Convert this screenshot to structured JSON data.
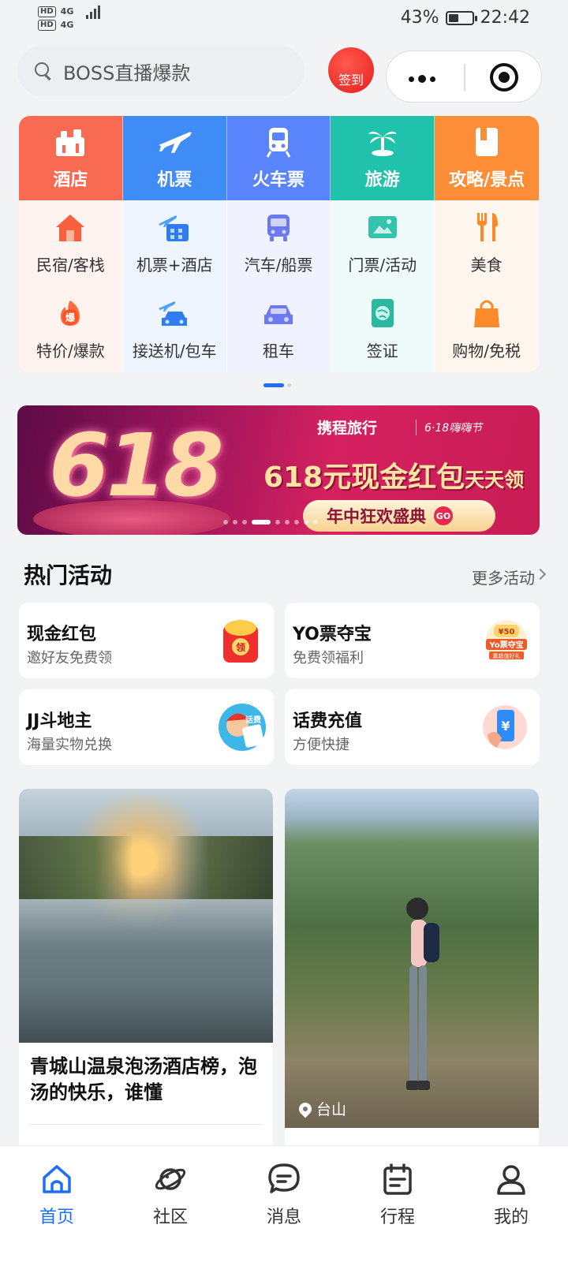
{
  "status_bar": {
    "sim1": "HD",
    "sim2": "HD",
    "net1": "4G",
    "net2": "4G",
    "battery": "43%",
    "battery_level": 0.43,
    "time": "22:42"
  },
  "search": {
    "placeholder": "BOSS直播爆款"
  },
  "signin": {
    "label": "签到"
  },
  "main_services": [
    {
      "label": "酒店",
      "icon": "hotel-icon",
      "color": "#f86a52"
    },
    {
      "label": "机票",
      "icon": "plane-icon",
      "color": "#3f8cf6"
    },
    {
      "label": "火车票",
      "icon": "train-icon",
      "color": "#5a84fb"
    },
    {
      "label": "旅游",
      "icon": "palm-tree-icon",
      "color": "#21c2ac"
    },
    {
      "label": "攻略/景点",
      "icon": "guide-book-icon",
      "color": "#fd8d36"
    }
  ],
  "sub_services_row1": [
    {
      "label": "民宿/客栈",
      "icon": "house-icon"
    },
    {
      "label": "机票+酒店",
      "icon": "plane-hotel-icon"
    },
    {
      "label": "汽车/船票",
      "icon": "bus-icon"
    },
    {
      "label": "门票/活动",
      "icon": "ticket-icon"
    },
    {
      "label": "美食",
      "icon": "fork-knife-icon"
    }
  ],
  "sub_services_row2": [
    {
      "label": "特价/爆款",
      "icon": "flame-deal-icon",
      "badge": "爆"
    },
    {
      "label": "接送机/包车",
      "icon": "airport-car-icon"
    },
    {
      "label": "租车",
      "icon": "car-icon"
    },
    {
      "label": "签证",
      "icon": "visa-icon"
    },
    {
      "label": "购物/免税",
      "icon": "shopping-bag-icon"
    }
  ],
  "banner": {
    "big_text": "618",
    "brand": "携程旅行",
    "festival": "6·18嗨嗨节",
    "headline_main": "618元现金红包",
    "headline_sub": "天天领",
    "pill": "年中狂欢盛典",
    "go": "GO"
  },
  "hot": {
    "title": "热门活动",
    "more": "更多活动",
    "cards": [
      {
        "title": "现金红包",
        "subtitle": "邀好友免费领",
        "icon": "red-envelope-icon",
        "badge": "领"
      },
      {
        "title": "YO票夺宝",
        "subtitle": "免费领福利",
        "icon": "yo-ticket-icon",
        "badge_top": "¥50",
        "badge_mid": "Yo票夺宝",
        "badge_bottom": "赢超值好礼"
      },
      {
        "title": "JJ斗地主",
        "subtitle": "海量实物兑换",
        "icon": "card-game-icon",
        "badge": "话费"
      },
      {
        "title": "话费充值",
        "subtitle": "方便快捷",
        "icon": "phone-recharge-icon",
        "badge": "¥"
      }
    ]
  },
  "feed": [
    {
      "title": "青城山温泉泡汤酒店榜，泡汤的快乐，谁懂"
    },
    {
      "location": "台山"
    }
  ],
  "tabs": [
    {
      "label": "首页",
      "icon": "home-icon",
      "active": true
    },
    {
      "label": "社区",
      "icon": "planet-icon",
      "active": false
    },
    {
      "label": "消息",
      "icon": "message-icon",
      "active": false
    },
    {
      "label": "行程",
      "icon": "calendar-icon",
      "active": false
    },
    {
      "label": "我的",
      "icon": "profile-icon",
      "active": false
    }
  ],
  "colors": {
    "accent": "#1e6ff5",
    "signin": "#e81d1d"
  }
}
